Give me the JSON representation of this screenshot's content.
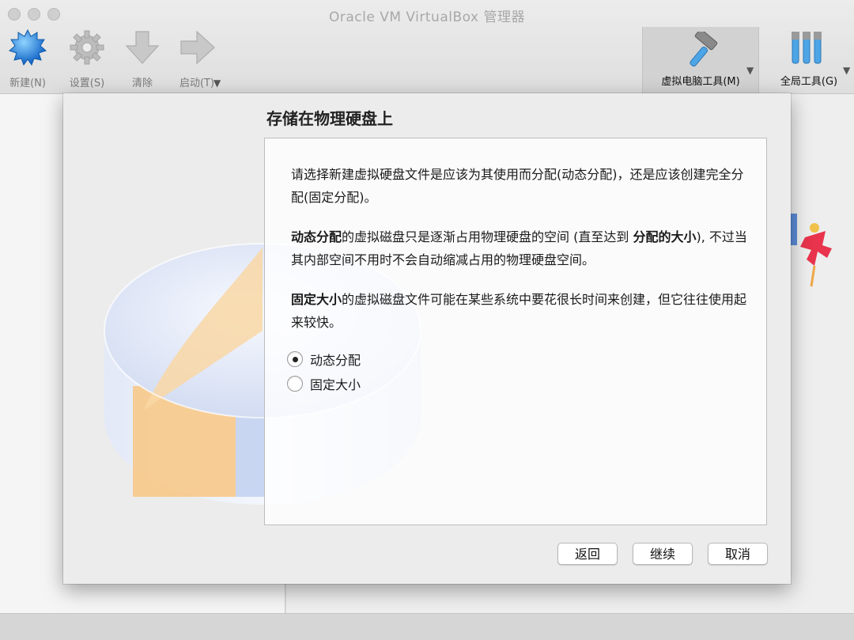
{
  "window": {
    "title": "Oracle VM VirtualBox 管理器"
  },
  "toolbar": {
    "new_label": "新建(N)",
    "settings_label": "设置(S)",
    "discard_label": "清除",
    "start_label": "启动(T)",
    "machine_tools_label": "虚拟电脑工具(M)",
    "global_tools_label": "全局工具(G)"
  },
  "dialog": {
    "title": "存储在物理硬盘上",
    "intro": "请选择新建虚拟硬盘文件是应该为其使用而分配(动态分配)，还是应该创建完全分配(固定分配)。",
    "dynamic_desc": {
      "strong1": "动态分配",
      "text1": "的虚拟磁盘只是逐渐占用物理硬盘的空间 (直至达到 ",
      "strong2": "分配的大小",
      "text2": "), 不过当其内部空间不用时不会自动缩减占用的物理硬盘空间。"
    },
    "fixed_desc": {
      "strong1": "固定大小",
      "text1": "的虚拟磁盘文件可能在某些系统中要花很长时间来创建，但它往往使用起来较快。"
    },
    "options": [
      {
        "label": "动态分配",
        "selected": true
      },
      {
        "label": "固定大小",
        "selected": false
      }
    ],
    "buttons": {
      "back": "返回",
      "continue": "继续",
      "cancel": "取消"
    }
  },
  "colors": {
    "accent": "#3a8ee6",
    "chart_orange": "#f7c98a",
    "disk_blue": "#c9d6f2"
  }
}
